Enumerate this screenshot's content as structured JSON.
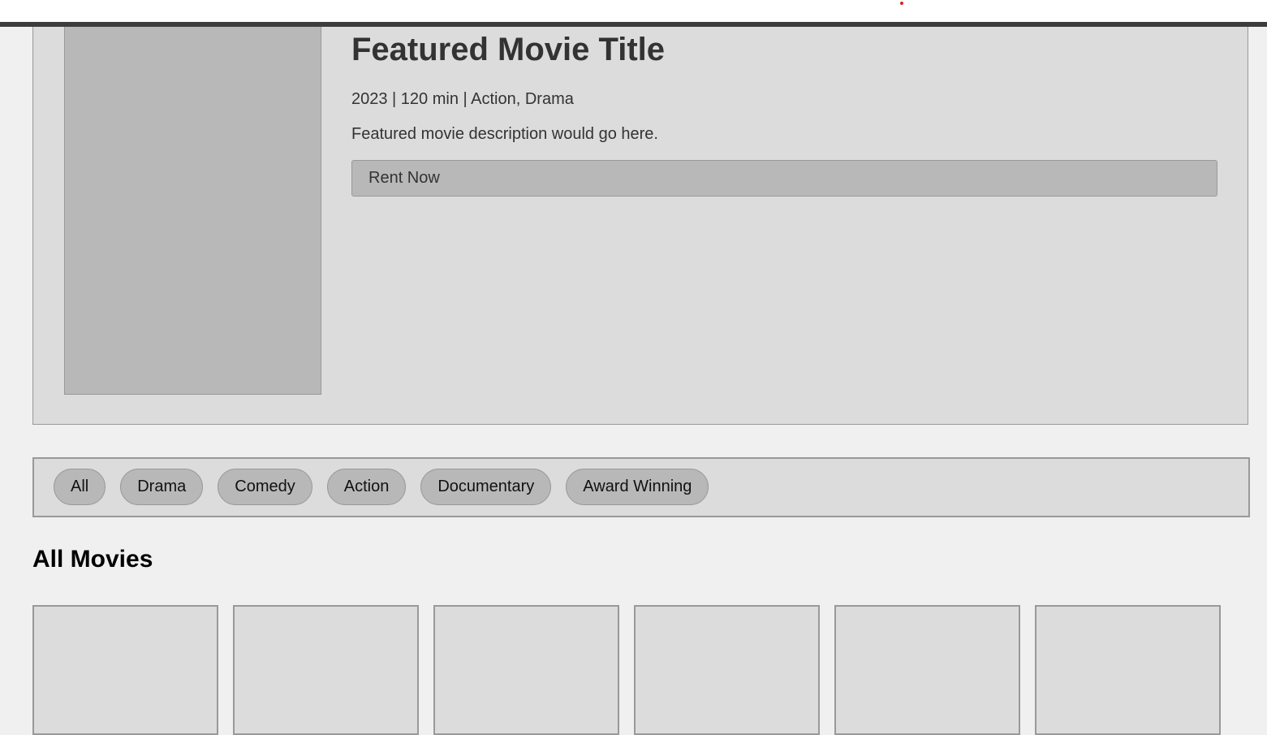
{
  "featured": {
    "title": "Featured Movie Title",
    "meta": "2023 | 120 min | Action, Drama",
    "description": "Featured movie description would go here.",
    "rent_label": "Rent Now"
  },
  "filters": {
    "chips": [
      "All",
      "Drama",
      "Comedy",
      "Action",
      "Documentary",
      "Award Winning"
    ]
  },
  "movies": {
    "heading": "All Movies",
    "card_count_visible": 6
  },
  "colors": {
    "page_background": "#f0f0f0",
    "panel_background": "#dcdcdc",
    "placeholder_gray": "#b8b8b8",
    "header_bar": "#3c3c3c",
    "border": "#999999",
    "indicator_red": "#e02020"
  }
}
